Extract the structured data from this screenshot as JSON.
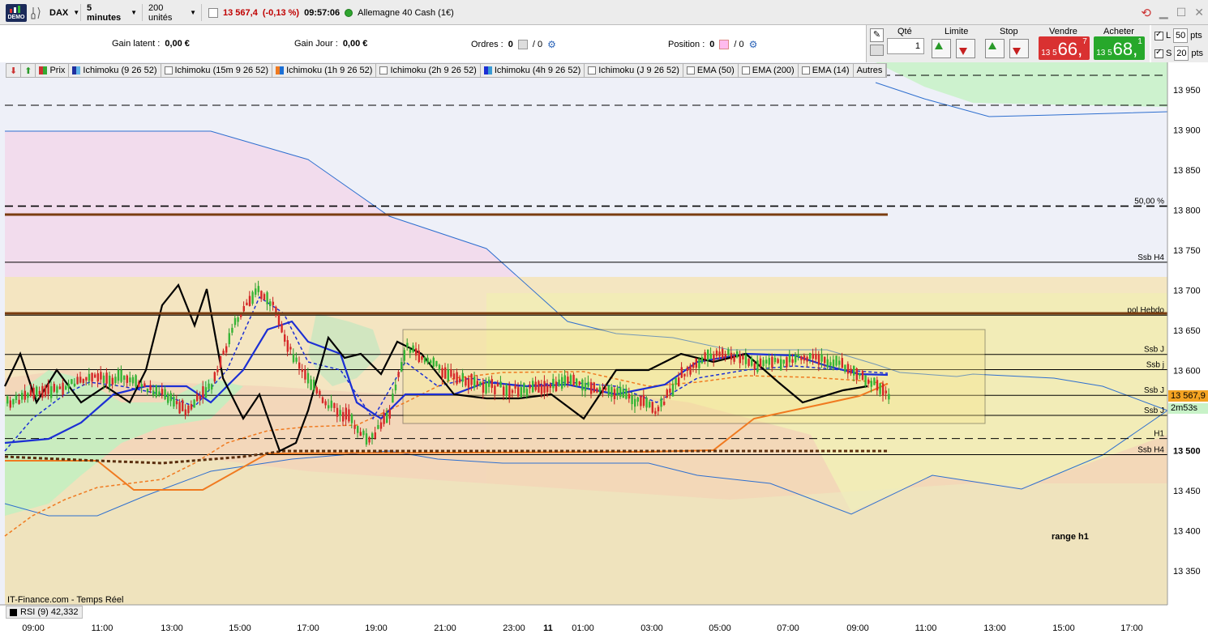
{
  "toolbar": {
    "logo_text": "DEMO",
    "symbol": "DAX",
    "timeframe": "5 minutes",
    "units": "200 unités",
    "price": "13 567,4",
    "change": "(-0,13 %)",
    "time": "09:57:06",
    "instrument": "Allemagne 40 Cash (1€)"
  },
  "info": {
    "gain_latent_label": "Gain latent :",
    "gain_latent_value": "0,00 €",
    "gain_jour_label": "Gain Jour :",
    "gain_jour_value": "0,00 €",
    "ordres_label": "Ordres :",
    "ordres_value": "0",
    "ordres_value2": "/ 0",
    "position_label": "Position :",
    "position_value": "0",
    "position_value2": "/ 0"
  },
  "orders": {
    "qty_label": "Qté",
    "qty_value": "1",
    "limite_label": "Limite",
    "stop_label": "Stop",
    "vendre_label": "Vendre",
    "vendre_small": "13 5",
    "vendre_big": "66,",
    "vendre_sup": "7",
    "acheter_label": "Acheter",
    "acheter_small": "13 5",
    "acheter_big": "68,",
    "acheter_sup": "1",
    "l_label": "L",
    "l_value": "50",
    "s_label": "S",
    "s_value": "20",
    "pts": "pts"
  },
  "tabs": [
    "Prix",
    "Ichimoku (9 26 52)",
    "Ichimoku (15m 9 26 52)",
    "Ichimoku (1h 9 26 52)",
    "Ichimoku (2h 9 26 52)",
    "Ichimoku (4h 9 26 52)",
    "Ichimoku (J 9 26 52)",
    "EMA (50)",
    "EMA (200)",
    "EMA (14)",
    "Autres"
  ],
  "chart_data": {
    "type": "candlestick",
    "y_ticks": [
      "13 950",
      "13 900",
      "13 850",
      "13 800",
      "13 750",
      "13 700",
      "13 650",
      "13 600",
      "13 550",
      "13 500",
      "13 450",
      "13 400",
      "13 350"
    ],
    "x_ticks": [
      "09:00",
      "11:00",
      "13:00",
      "15:00",
      "17:00",
      "19:00",
      "21:00",
      "23:00",
      "11",
      "01:00",
      "03:00",
      "05:00",
      "07:00",
      "09:00",
      "11:00",
      "13:00",
      "15:00",
      "17:00"
    ],
    "current_price": "13 567,9",
    "timer": "2m53s",
    "levels": [
      {
        "label": "50,00 %",
        "value": 13805
      },
      {
        "label": "Ssb H4",
        "value": 13735
      },
      {
        "label": "pol Hebdo",
        "value": 13669
      },
      {
        "label": "Ssb J",
        "value": 13620
      },
      {
        "label": "Ssb j",
        "value": 13601
      },
      {
        "label": "Ssb J",
        "value": 13569
      },
      {
        "label": "Ssb J",
        "value": 13544
      },
      {
        "label": "H1",
        "value": 13515
      },
      {
        "label": "Ssb H4",
        "value": 13495
      }
    ],
    "annotation": "range h1",
    "range_box": {
      "high": 13652,
      "low": 13544
    }
  },
  "footer": {
    "watermark": "IT-Finance.com - Temps Réel",
    "rsi": "RSI (9) 42,332"
  }
}
